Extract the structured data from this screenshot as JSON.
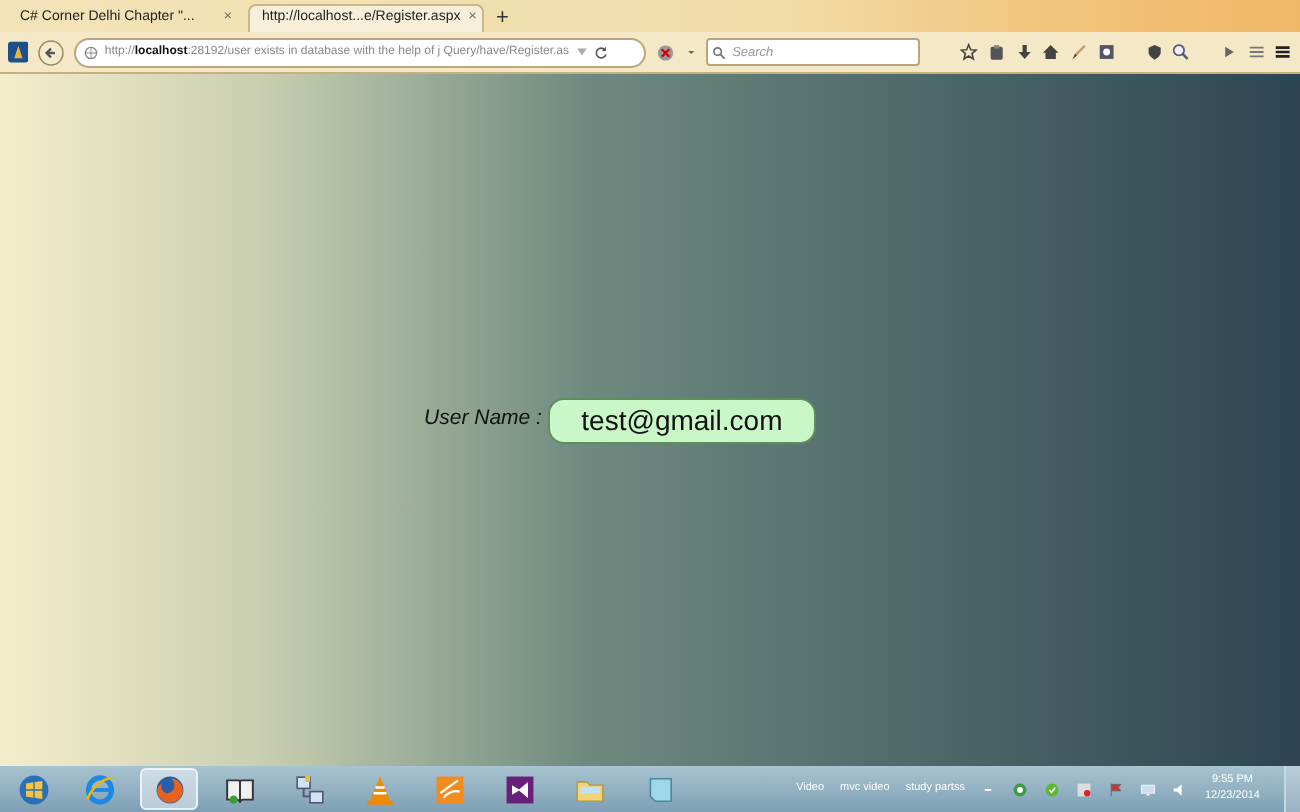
{
  "browser": {
    "tabs": [
      {
        "title": "C# Corner Delhi Chapter \"...",
        "close": "×",
        "selected": false
      },
      {
        "title": "http://localhost...e/Register.aspx",
        "close": "×",
        "selected": true
      }
    ],
    "new_tab": "+",
    "url": {
      "scheme": "http://",
      "host": "localhost",
      "rest": ":28192/user exists in database with the help of j Query/have/Register.as"
    },
    "search": {
      "placeholder": "Search"
    }
  },
  "form": {
    "label": "User Name :",
    "value": "test@gmail.com"
  },
  "taskbar": {
    "apps": [
      {
        "kind": "start",
        "active": false
      },
      {
        "kind": "ie",
        "active": false
      },
      {
        "kind": "firefox",
        "active": true
      },
      {
        "kind": "book",
        "active": false
      },
      {
        "kind": "network",
        "active": false
      },
      {
        "kind": "vlc",
        "active": false
      },
      {
        "kind": "pdf",
        "active": false
      },
      {
        "kind": "vs",
        "active": false
      },
      {
        "kind": "folder",
        "active": false
      },
      {
        "kind": "notes",
        "active": false
      }
    ],
    "toolbars": [
      "Video",
      "mvc video",
      "study partss"
    ],
    "time": "9:55 PM",
    "date": "12/23/2014"
  }
}
